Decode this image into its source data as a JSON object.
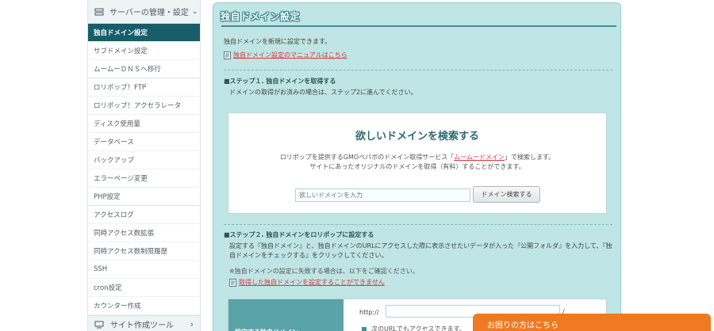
{
  "sidebar": {
    "header_label": "サーバーの管理・設定",
    "header_icon": "server-icon",
    "items": [
      {
        "label": "独自ドメイン設定",
        "active": true
      },
      {
        "label": "サブドメイン設定"
      },
      {
        "label": "ムームーＤＮＳへ移行"
      },
      {
        "label": "ロリポップ！FTP"
      },
      {
        "label": "ロリポップ！アクセラレータ"
      },
      {
        "label": "ディスク使用量"
      },
      {
        "label": "データベース"
      },
      {
        "label": "バックアップ"
      },
      {
        "label": "エラーページ変更"
      },
      {
        "label": "PHP設定"
      },
      {
        "label": "アクセスログ"
      },
      {
        "label": "同時アクセス数拡張"
      },
      {
        "label": "同時アクセス数制限履歴"
      },
      {
        "label": "SSH"
      },
      {
        "label": "cron設定"
      },
      {
        "label": "カウンター作成"
      }
    ],
    "footer_label": "サイト作成ツール",
    "footer_icon": "monitor-icon"
  },
  "main": {
    "title": "独自ドメイン設定",
    "intro": "独自ドメインを新規に設定できます。",
    "manual_link": "独自ドメイン設定のマニュアルはこちら",
    "step1": {
      "title": "■ステップ１. 独自ドメインを取得する",
      "desc": "ドメインの取得がお済みの場合は、ステップ2に進んでください。"
    },
    "search": {
      "title": "欲しいドメインを検索する",
      "desc_pre": "ロリポップを提供するGMOペパボのドメイン取得サービス「",
      "desc_link": "ムームードメイン",
      "desc_post": "」で検索します。",
      "desc_line2": "サイトにあったオリジナルのドメインを取得（有料）することができます。",
      "placeholder": "欲しいドメインを入力",
      "button": "ドメイン検索する"
    },
    "step2": {
      "title": "■ステップ２. 独自ドメインをロリポップに設定する",
      "desc": "設定する『独自ドメイン』と、独自ドメインのURLにアクセスした際に表示させたいデータが入った『公開フォルダ』を入力して、『独自ドメインをチェックする』をクリックしてください。",
      "note": "※独自ドメインの設定に失敗する場合は、以下をご確認ください。",
      "fail_link": "取得した独自ドメインを設定することができません"
    },
    "form": {
      "row_label": "設定する独自ドメイン",
      "http_prefix": "http://",
      "slash": "/",
      "url_note": "次のURLでもアクセスできます。"
    }
  },
  "help_button": "お困りの方はこちら",
  "colors": {
    "panel_bg": "#bfe5e4",
    "active_item": "#185d6a",
    "link": "#e0343a",
    "help": "#f07a22"
  }
}
